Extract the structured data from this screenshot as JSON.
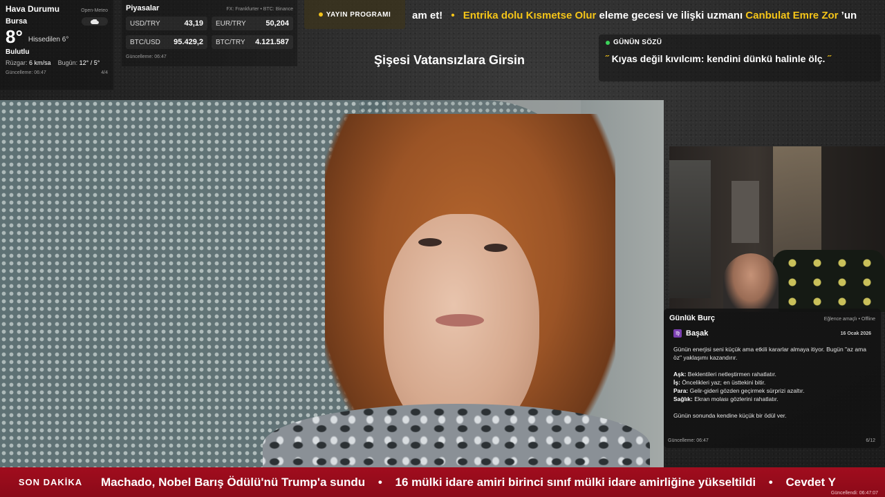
{
  "weather": {
    "title": "Hava Durumu",
    "source": "Open-Meteo",
    "city": "Bursa",
    "temperature": "8°",
    "feels_like": "Hissedilen 6°",
    "condition": "Bulutlu",
    "wind_label": "Rüzgar:",
    "wind_value": "6 km/sa",
    "today_label": "Bugün:",
    "today_value": "12° / 5°",
    "updated": "Güncelleme: 06:47",
    "page": "4/4",
    "icon": "cloud-icon"
  },
  "markets": {
    "title": "Piyasalar",
    "source": "FX: Frankfurter • BTC: Binance",
    "rates": [
      {
        "label": "USD/TRY",
        "value": "43,19"
      },
      {
        "label": "EUR/TRY",
        "value": "50,204"
      },
      {
        "label": "BTC/USD",
        "value": "95.429,2"
      },
      {
        "label": "BTC/TRY",
        "value": "4.121.587"
      }
    ],
    "updated": "Güncelleme: 06:47"
  },
  "program": {
    "label": "YAYIN PROGRAMI"
  },
  "top_ticker": {
    "lead": "am et!",
    "highlight1": "Entrika dolu Kısmetse Olur",
    "middle": " eleme gecesi ve ilişki uzmanı ",
    "highlight2": "Canbulat Emre Zor",
    "tail": "’un"
  },
  "show_title": "Şişesi Vatansızlara Girsin",
  "quote": {
    "title": "GÜNÜN SÖZÜ",
    "open_mark": "˝",
    "text": "Kıyas değil kıvılcım: kendini dünkü halinle ölç.",
    "close_mark": "˝"
  },
  "horoscope": {
    "title": "Günlük Burç",
    "note": "Eğlence amaçlı • Offline",
    "sign": "Başak",
    "sign_badge": "♍",
    "date": "16 Ocak 2026",
    "intro": "Günün enerjisi seni küçük ama etkili kararlar almaya itiyor. Bugün \"az ama öz\" yaklaşımı kazandırır.",
    "items": [
      {
        "key": "Aşk:",
        "text": " Beklentileri netleştirmen rahatlatır."
      },
      {
        "key": "İş:",
        "text": " Öncelikleri yaz; en üsttekini bitir."
      },
      {
        "key": "Para:",
        "text": " Gelir-gideri gözden geçirmek sürprizi azaltır."
      },
      {
        "key": "Sağlık:",
        "text": " Ekran molası gözlerini rahatlatır."
      }
    ],
    "closing": "Günün sonunda kendine küçük bir ödül ver.",
    "updated": "Güncelleme: 06:47",
    "page": "6/12"
  },
  "breaking": {
    "label": "SON DAKİKA",
    "items": [
      "Machado, Nobel Barış Ödülü'nü Trump'a sundu",
      "16 mülki idare amiri birinci sınıf mülki idare amirliğine yükseltildi",
      "Cevdet Y"
    ],
    "separator": "•",
    "updated": "Güncellendi: 06:47:07"
  }
}
